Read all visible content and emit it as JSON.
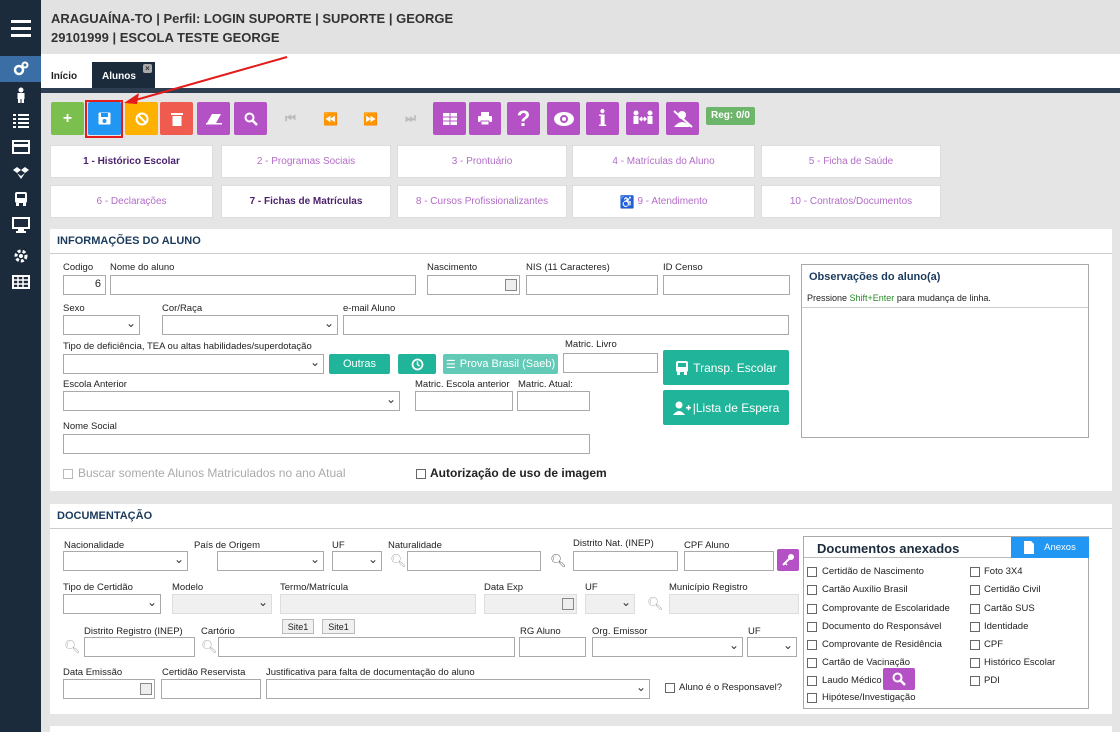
{
  "header": {
    "line1": "ARAGUAÍNA-TO | Perfil: LOGIN SUPORTE | SUPORTE | GEORGE",
    "line2": "29101999 | ESCOLA TESTE GEORGE"
  },
  "tabs": {
    "home": "Início",
    "alunos": "Alunos",
    "close": "×"
  },
  "toolbar": {
    "reg": "Reg: 0/0"
  },
  "sections": [
    "1 - Histórico Escolar",
    "2 - Programas Sociais",
    "3 - Prontuário",
    "4 - Matrículas do Aluno",
    "5 - Ficha de Saúde",
    "6 - Declarações",
    "7 - Fichas de Matrículas",
    "8 - Cursos Profissionalizantes",
    "9 - Atendimento",
    "10 - Contratos/Documentos"
  ],
  "aluno": {
    "title": "INFORMAÇÕES DO ALUNO",
    "codigo_label": "Codigo",
    "codigo_value": "6",
    "nome_label": "Nome do aluno",
    "nascimento_label": "Nascimento",
    "nis_label": "NIS (11 Caracteres)",
    "idcenso_label": "ID Censo",
    "sexo_label": "Sexo",
    "cor_label": "Cor/Raça",
    "email_label": "e-mail Aluno",
    "deficiencia_label": "Tipo de deficiência, TEA ou altas habilidades/superdotação",
    "outras": "Outras",
    "prova_brasil": "Prova Brasil (Saeb)",
    "matric_livro_label": "Matric. Livro",
    "transp": "Transp. Escolar",
    "lista": "|Lista de Espera",
    "escola_anterior_label": "Escola Anterior",
    "matric_escola_label": "Matric. Escola anterior",
    "matric_atual_label": "Matric. Atual:",
    "nome_social_label": "Nome Social",
    "buscar": "Buscar somente Alunos Matriculados no ano Atual",
    "autorizacao": "Autorização de uso de imagem",
    "obs_title": "Observações do aluno(a)",
    "obs_hint_pre": "Pressione ",
    "obs_hint_key": "Shift+Enter",
    "obs_hint_post": " para mudança de linha."
  },
  "doc": {
    "title": "DOCUMENTAÇÃO",
    "nacionalidade": "Nacionalidade",
    "pais": "País de Origem",
    "uf": "UF",
    "naturalidade": "Naturalidade",
    "distrito": "Distrito Nat. (INEP)",
    "cpf_aluno": "CPF Aluno",
    "tipo_certidao": "Tipo de Certidão",
    "modelo": "Modelo",
    "termo": "Termo/Matrícula",
    "data_exp": "Data Exp",
    "uf2": "UF",
    "municipio": "Município Registro",
    "site1": "Site1",
    "site2": "Site1",
    "distrito_reg": "Distrito Registro (INEP)",
    "cartorio": "Cartório",
    "rg": "RG Aluno",
    "orgao": "Org. Emissor",
    "uf3": "UF",
    "data_emissao": "Data Emissão",
    "reservista": "Certidão Reservista",
    "justificativa": "Justificativa para falta de documentação do aluno",
    "responsavel": "Aluno é o Responsavel?",
    "anexados_title": "Documentos anexados",
    "anexos_btn": "Anexos",
    "docs_left": [
      "Certidão de Nascimento",
      "Cartão Auxílio Brasil",
      "Comprovante de Escolaridade",
      "Documento do Responsável",
      "Comprovante de Residência",
      "Cartão de Vacinação",
      "Laudo Médico",
      "Hipótese/Investigação"
    ],
    "docs_right": [
      "Foto 3X4",
      "Certidão Civil",
      "Cartão SUS",
      "Identidade",
      "CPF",
      "Histórico Escolar",
      "PDI"
    ]
  }
}
